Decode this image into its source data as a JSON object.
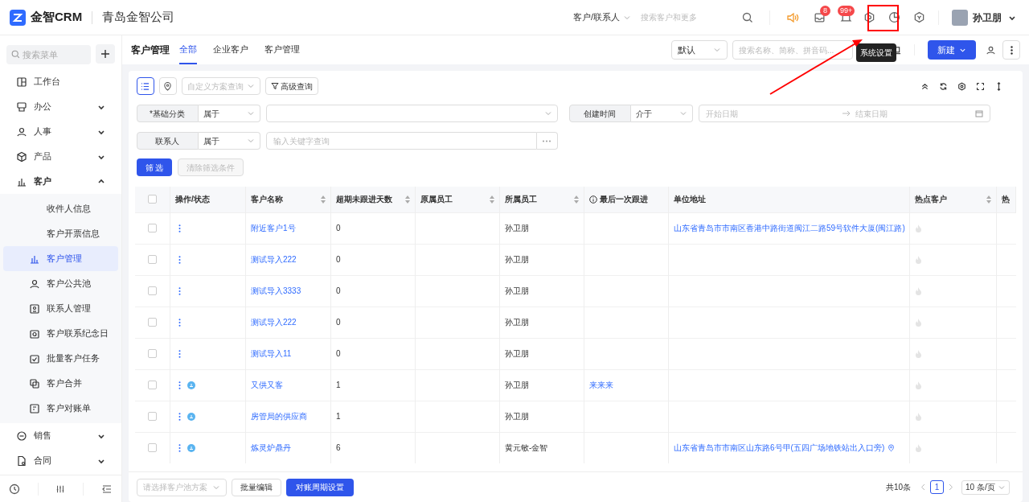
{
  "header": {
    "logo": "金智CRM",
    "company": "青岛金智公司",
    "search_scope": "客户/联系人",
    "search_placeholder": "搜索客户和更多",
    "mail_badge": "8",
    "bell_badge": "99+",
    "user": "孙卫朋",
    "tooltip": "系统设置"
  },
  "sidebar": {
    "search_placeholder": "搜索菜单",
    "items": [
      {
        "label": "工作台",
        "selected": false
      },
      {
        "label": "办公",
        "expanded": false,
        "selected": false
      },
      {
        "label": "人事",
        "expanded": false,
        "selected": false
      },
      {
        "label": "产品",
        "expanded": false,
        "selected": false
      },
      {
        "label": "客户",
        "expanded": true,
        "selected": false,
        "children": [
          {
            "label": "收件人信息",
            "selected": false
          },
          {
            "label": "客户开票信息",
            "selected": false
          },
          {
            "label": "客户管理",
            "selected": true
          },
          {
            "label": "客户公共池",
            "selected": false
          },
          {
            "label": "联系人管理",
            "selected": false
          },
          {
            "label": "客户联系纪念日",
            "selected": false
          },
          {
            "label": "批量客户任务",
            "selected": false
          },
          {
            "label": "客户合并",
            "selected": false
          },
          {
            "label": "客户对账单",
            "selected": false
          }
        ]
      },
      {
        "label": "销售",
        "expanded": false,
        "selected": false
      },
      {
        "label": "合同",
        "expanded": false,
        "selected": false
      }
    ]
  },
  "page": {
    "title": "客户管理",
    "tabs": [
      {
        "label": "全部",
        "selected": true
      },
      {
        "label": "企业客户",
        "selected": false
      },
      {
        "label": "客户管理",
        "selected": false
      }
    ],
    "view_select": "默认",
    "search_placeholder": "搜索名称、简称、拼音码...",
    "new_button": "新建"
  },
  "filters": {
    "scheme_placeholder": "自定义方案查询",
    "advanced": "高级查询",
    "conditions": [
      {
        "kind": "select",
        "label": "*基础分类",
        "operator": "属于"
      },
      {
        "kind": "daterange",
        "label": "创建时间",
        "operator": "介于",
        "start_placeholder": "开始日期",
        "end_placeholder": "结束日期"
      },
      {
        "kind": "keyword",
        "label": "联系人",
        "operator": "属于",
        "placeholder": "输入关键字查询"
      }
    ],
    "apply": "筛 选",
    "clear": {
      "label": "清除筛选条件",
      "disabled": true
    }
  },
  "table": {
    "all_checked": false,
    "columns": [
      {
        "label": "操作/状态"
      },
      {
        "label": "客户名称"
      },
      {
        "label": "超期未跟进天数"
      },
      {
        "label": "原属员工"
      },
      {
        "label": "所属员工"
      },
      {
        "label": "最后一次跟进"
      },
      {
        "label": "单位地址"
      },
      {
        "label": "热点客户"
      },
      {
        "label": "热"
      }
    ],
    "rows": [
      {
        "checked": false,
        "status_icon": false,
        "name": "附近客户1号",
        "overdue": "0",
        "owner": "孙卫朋",
        "address": "山东省青岛市市南区香港中路街道闽江二路59号软件大厦(闽江路)"
      },
      {
        "checked": false,
        "status_icon": false,
        "name": "测试导入222",
        "overdue": "0",
        "owner": "孙卫朋"
      },
      {
        "checked": false,
        "status_icon": false,
        "name": "测试导入3333",
        "overdue": "0",
        "owner": "孙卫朋"
      },
      {
        "checked": false,
        "status_icon": false,
        "name": "测试导入222",
        "overdue": "0",
        "owner": "孙卫朋"
      },
      {
        "checked": false,
        "status_icon": false,
        "name": "测试导入11",
        "overdue": "0",
        "owner": "孙卫朋"
      },
      {
        "checked": false,
        "status_icon": true,
        "name": "又供又客",
        "overdue": "1",
        "owner": "孙卫朋",
        "last_follow": "来来来"
      },
      {
        "checked": false,
        "status_icon": true,
        "name": "房管局的供应商",
        "overdue": "1",
        "owner": "孙卫朋"
      },
      {
        "checked": false,
        "status_icon": true,
        "name": "炼灵炉鼎丹",
        "overdue": "6",
        "owner": "黄元敏-金智",
        "address": "山东省青岛市市南区山东路6号甲(五四广场地铁站出入口旁)"
      }
    ]
  },
  "footer": {
    "pool_placeholder": "请选择客户池方案",
    "bulk_edit": "批量编辑",
    "cycle_button": "对账周期设置",
    "total": "共10条",
    "page": "1",
    "page_size": "10 条/页"
  }
}
